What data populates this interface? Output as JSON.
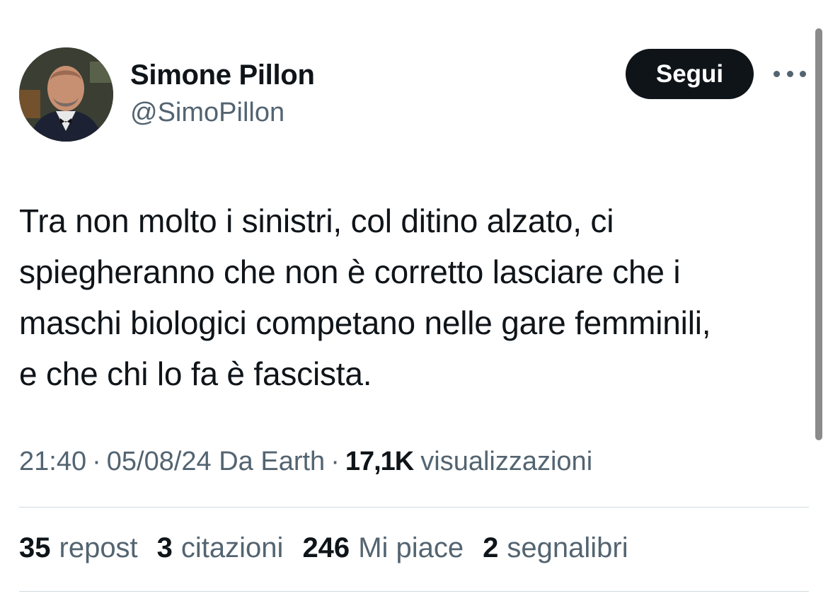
{
  "user": {
    "display_name": "Simone Pillon",
    "handle": "@SimoPillon"
  },
  "actions": {
    "follow_label": "Segui",
    "more_icon": "more-horizontal-icon"
  },
  "tweet": {
    "lines": [
      "Tra non molto i sinistri, col ditino alzato, ci",
      "spiegheranno che non è corretto lasciare che i",
      "maschi biologici competano nelle gare femminili,",
      "e che chi lo fa è fascista."
    ]
  },
  "meta": {
    "time": "21:40",
    "separator": "·",
    "date_source": "05/08/24 Da Earth",
    "views_count": "17,1K",
    "views_label": "visualizzazioni"
  },
  "stats": [
    {
      "count": "35",
      "label": "repost"
    },
    {
      "count": "3",
      "label": "citazioni"
    },
    {
      "count": "246",
      "label": "Mi piace"
    },
    {
      "count": "2",
      "label": "segnalibri"
    }
  ],
  "colors": {
    "text_primary": "#0f1419",
    "text_secondary": "#536471",
    "button_bg": "#0f1419",
    "divider": "#cfd9de"
  }
}
